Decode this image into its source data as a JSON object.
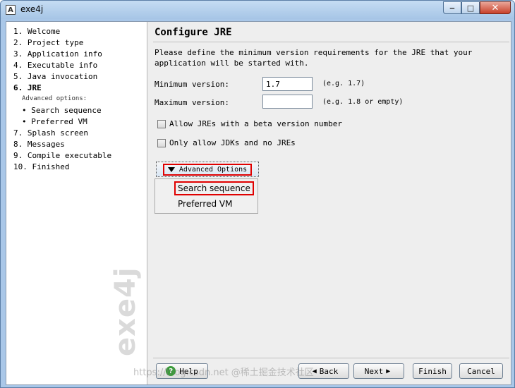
{
  "window": {
    "title": "exe4j",
    "app_icon": "A"
  },
  "window_buttons": {
    "minimize": "‒",
    "maximize": "□",
    "close": "✕"
  },
  "sidebar": {
    "steps": [
      "1. Welcome",
      "2. Project type",
      "3. Application info",
      "4. Executable info",
      "5. Java invocation",
      "6. JRE",
      "Advanced options:",
      "• Search sequence",
      "• Preferred VM",
      "7. Splash screen",
      "8. Messages",
      "9. Compile executable",
      "10. Finished"
    ],
    "active_step": "6. JRE",
    "brand": "exe4j"
  },
  "main": {
    "title": "Configure JRE",
    "description": "Please define the minimum version requirements for the JRE that your application will be started with.",
    "min_version": {
      "label": "Minimum version:",
      "value": "1.7",
      "hint": "(e.g. 1.7)"
    },
    "max_version": {
      "label": "Maximum version:",
      "value": "",
      "hint": "(e.g. 1.8 or empty)"
    },
    "checkbox_beta": {
      "label": "Allow JREs with a beta version number",
      "checked": false
    },
    "checkbox_jdk": {
      "label": "Only allow JDKs and no JREs",
      "checked": false
    },
    "advanced_button": "Advanced Options",
    "advanced_menu": [
      "Search sequence",
      "Preferred VM"
    ]
  },
  "footer": {
    "help": "Help",
    "back": "Back",
    "next": "Next",
    "finish": "Finish",
    "cancel": "Cancel"
  },
  "watermark": "https://blog.csdn.net  @稀土掘金技术社区"
}
